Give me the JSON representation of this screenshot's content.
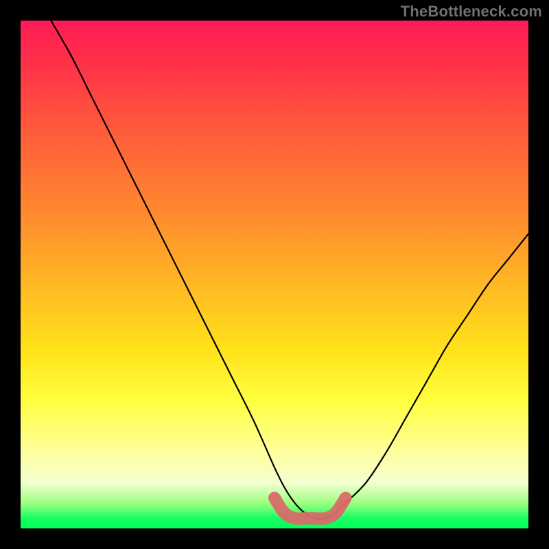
{
  "watermark": "TheBottleneck.com",
  "chart_data": {
    "type": "line",
    "title": "",
    "xlabel": "",
    "ylabel": "",
    "xlim": [
      0,
      100
    ],
    "ylim": [
      0,
      100
    ],
    "grid": false,
    "legend": false,
    "series": [
      {
        "name": "main-curve",
        "color": "#000000",
        "x": [
          6,
          10,
          14,
          18,
          22,
          26,
          30,
          34,
          38,
          42,
          46,
          50,
          52,
          54,
          56,
          58,
          60,
          62,
          64,
          68,
          72,
          76,
          80,
          84,
          88,
          92,
          96,
          100
        ],
        "y": [
          100,
          93,
          85,
          77,
          69,
          61,
          53,
          45,
          37,
          29,
          21,
          12,
          8,
          5,
          3,
          2,
          2,
          3,
          5,
          9,
          15,
          22,
          29,
          36,
          42,
          48,
          53,
          58
        ]
      },
      {
        "name": "highlight-band",
        "color": "#d96a6a",
        "x": [
          50,
          52,
          54,
          56,
          58,
          60,
          62,
          64
        ],
        "y": [
          6,
          3,
          2,
          2,
          2,
          2,
          3,
          6
        ]
      }
    ],
    "gradient_stops": [
      {
        "pos": 0,
        "color": "#ff1a55"
      },
      {
        "pos": 10,
        "color": "#ff3647"
      },
      {
        "pos": 22,
        "color": "#ff5c3a"
      },
      {
        "pos": 38,
        "color": "#ff8a2e"
      },
      {
        "pos": 52,
        "color": "#ffb824"
      },
      {
        "pos": 65,
        "color": "#ffe31a"
      },
      {
        "pos": 75,
        "color": "#ffff40"
      },
      {
        "pos": 85,
        "color": "#ffff9e"
      },
      {
        "pos": 91,
        "color": "#f3ffcf"
      },
      {
        "pos": 95,
        "color": "#9cff80"
      },
      {
        "pos": 98,
        "color": "#18ff62"
      },
      {
        "pos": 100,
        "color": "#00ff5a"
      }
    ]
  }
}
